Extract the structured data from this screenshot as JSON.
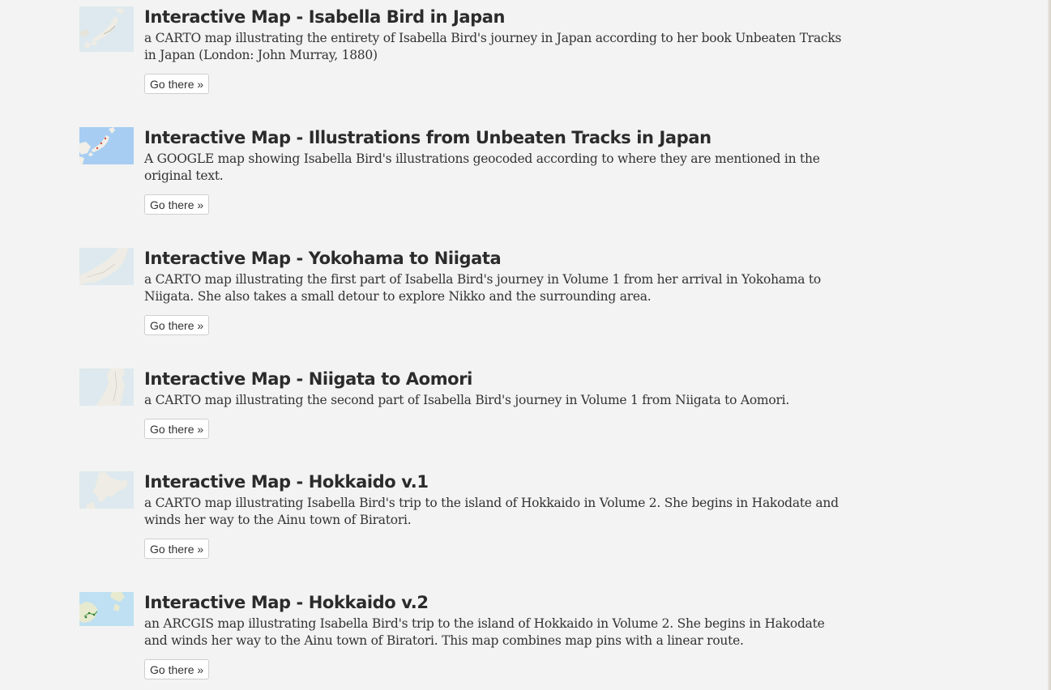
{
  "items": [
    {
      "title": "Interactive Map - Isabella Bird in Japan",
      "description": "a CARTO map illustrating the entirety of Isabella Bird's journey in Japan according to her book Unbeaten Tracks in Japan (London: John Murray, 1880)",
      "button": "Go there »",
      "thumbnail_icon": "japan-map-thumbnail-icon"
    },
    {
      "title": "Interactive Map - Illustrations from Unbeaten Tracks in Japan",
      "description": "A GOOGLE map showing Isabella Bird's illustrations geocoded according to where they are mentioned in the original text.",
      "button": "Go there »",
      "thumbnail_icon": "google-map-thumbnail-icon"
    },
    {
      "title": "Interactive Map - Yokohama to Niigata",
      "description": "a CARTO map illustrating the first part of Isabella Bird's journey in Volume 1 from her arrival in Yokohama to Niigata. She also takes a small detour to explore Nikko and the surrounding area.",
      "button": "Go there »",
      "thumbnail_icon": "honshu-map-thumbnail-icon"
    },
    {
      "title": "Interactive Map - Niigata to Aomori",
      "description": "a CARTO map illustrating the second part of Isabella Bird's journey in Volume 1 from Niigata to Aomori.",
      "button": "Go there »",
      "thumbnail_icon": "north-honshu-map-thumbnail-icon"
    },
    {
      "title": "Interactive Map - Hokkaido v.1",
      "description": "a CARTO map illustrating Isabella Bird's trip to the island of Hokkaido in Volume 2. She begins in Hakodate and winds her way to the Ainu town of Biratori.",
      "button": "Go there »",
      "thumbnail_icon": "hokkaido-map-thumbnail-icon"
    },
    {
      "title": "Interactive Map - Hokkaido v.2",
      "description": "an ARCGIS map illustrating Isabella Bird's trip to the island of Hokkaido in Volume 2. She begins in Hakodate and winds her way to the Ainu town of Biratori. This map combines map pins with a linear route.",
      "button": "Go there »",
      "thumbnail_icon": "arcgis-map-thumbnail-icon"
    }
  ],
  "colors": {
    "background": "#f3f3f3",
    "title_text": "#2b2b2b",
    "body_text": "#333333",
    "button_border": "#cfcfcf",
    "map_water": "#dde9ee",
    "map_land": "#eeece4"
  }
}
